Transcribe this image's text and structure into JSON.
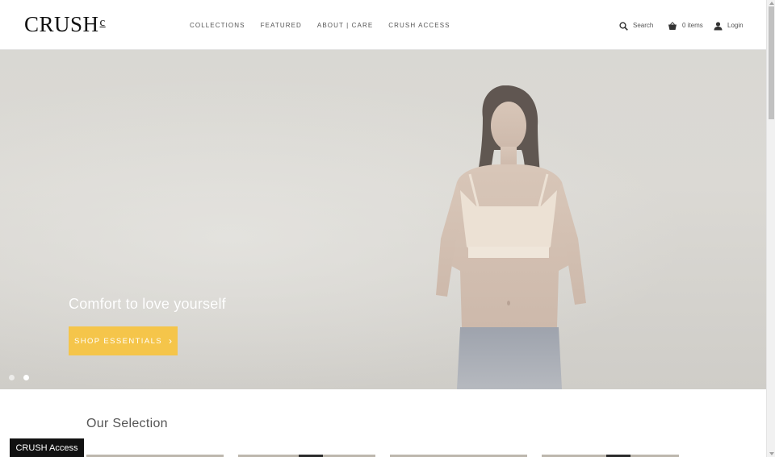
{
  "header": {
    "logo": "CRUSH",
    "logo_mark": "c",
    "nav": [
      "COLLECTIONS",
      "FEATURED",
      "ABOUT | CARE",
      "CRUSH ACCESS"
    ],
    "search_label": "Search",
    "cart_label": "0 items",
    "login_label": "Login"
  },
  "hero": {
    "caption": "Comfort to love yourself",
    "button_label": "SHOP ESSENTIALS",
    "button_chevron": "›",
    "slide_count": 2,
    "active_slide": 2
  },
  "selection": {
    "title": "Our Selection"
  },
  "access_button": "CRUSH Access",
  "colors": {
    "accent": "#f5c54a",
    "access_bg": "#111111"
  },
  "icons": [
    "search-icon",
    "basket-icon",
    "user-icon"
  ]
}
